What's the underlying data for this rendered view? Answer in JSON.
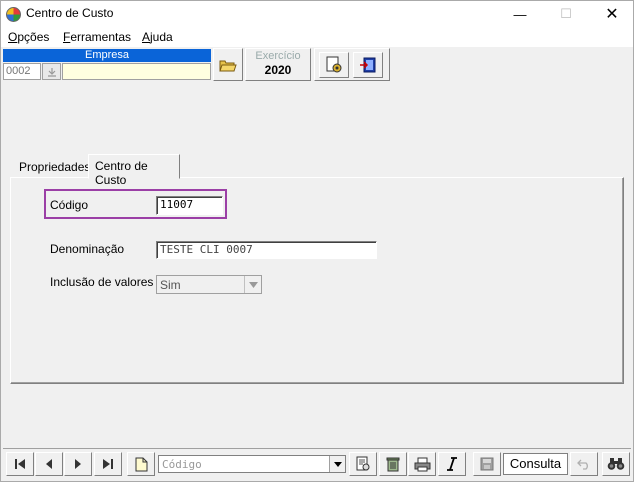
{
  "window": {
    "title": "Centro de Custo",
    "minimize": "—",
    "maximize": "☐",
    "close": "✕"
  },
  "menu": {
    "items": [
      {
        "label": "Opções",
        "mnemonic": "O",
        "rest": "pções"
      },
      {
        "label": "Ferramentas",
        "mnemonic": "F",
        "rest": "erramentas"
      },
      {
        "label": "Ajuda",
        "mnemonic": "A",
        "rest": "juda"
      }
    ]
  },
  "toolbar": {
    "empresa_label": "Empresa",
    "empresa_code": "0002",
    "empresa_name": "",
    "exercicio_label": "Exercício",
    "exercicio_value": "2020"
  },
  "tabs": [
    {
      "label": "Propriedades",
      "active": false
    },
    {
      "label": "Centro de Custo",
      "active": true
    }
  ],
  "form": {
    "codigo_label": "Código",
    "codigo_value": "11007",
    "denominacao_label": "Denominação",
    "denominacao_value": "TESTE CLI 0007",
    "inclusao_label": "Inclusão de valores ?",
    "inclusao_value": "Sim"
  },
  "bottom": {
    "search_placeholder": "Código",
    "mode_label": "Consulta"
  },
  "icons": [
    "first-record-icon",
    "prev-record-icon",
    "next-record-icon",
    "last-record-icon",
    "new-document-icon",
    "open-folder-icon",
    "binoculars-icon",
    "printer-icon",
    "trash-icon",
    "save-icon",
    "undo-icon"
  ],
  "colors": {
    "empresa_header": "#0a64d8",
    "empresa_name_bg": "#ffffe0",
    "highlight": "#9b3fa6"
  }
}
